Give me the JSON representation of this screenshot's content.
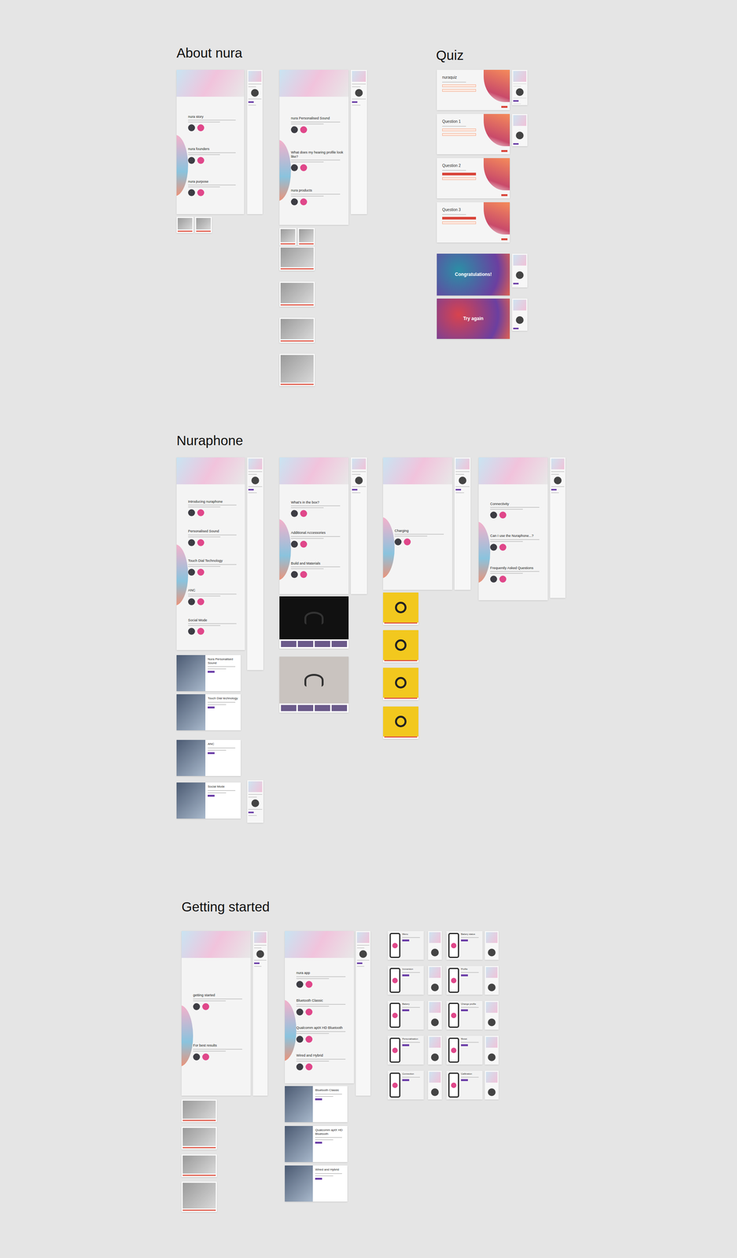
{
  "sections": [
    {
      "title": "About nura",
      "boards": [
        {
          "kind": "page",
          "headings": [
            "nura story",
            "nura founders",
            "nura purpose"
          ]
        },
        {
          "kind": "mobile"
        },
        {
          "kind": "thumb"
        },
        {
          "kind": "thumb"
        },
        {
          "kind": "page",
          "headings": [
            "nura Personalised Sound",
            "What does my hearing profile look like?",
            "nura products"
          ]
        },
        {
          "kind": "mobile"
        },
        {
          "kind": "thumb"
        },
        {
          "kind": "thumb"
        },
        {
          "kind": "thumb"
        },
        {
          "kind": "thumb"
        },
        {
          "kind": "thumb"
        },
        {
          "kind": "thumb"
        }
      ]
    },
    {
      "title": "Quiz",
      "boards": [
        {
          "kind": "quiz",
          "heading": "nuraquiz",
          "answered": false
        },
        {
          "kind": "mobile"
        },
        {
          "kind": "quiz",
          "heading": "Question 1",
          "answered": false
        },
        {
          "kind": "mobile"
        },
        {
          "kind": "quiz",
          "heading": "Question 2",
          "answered": true
        },
        {
          "kind": "quiz",
          "heading": "Question 3",
          "answered": true
        },
        {
          "kind": "result",
          "heading": "Congratulations!",
          "color": "#2b8fa6"
        },
        {
          "kind": "mobile"
        },
        {
          "kind": "result",
          "heading": "Try again",
          "color": "#d8434e"
        },
        {
          "kind": "mobile"
        }
      ]
    },
    {
      "title": "Nuraphone",
      "boards": [
        {
          "kind": "page",
          "headings": [
            "Introducing nuraphone",
            "Personalised Sound",
            "Touch Dial Technology",
            "ANC",
            "Social Mode"
          ]
        },
        {
          "kind": "mobile"
        },
        {
          "kind": "feature",
          "heading": "Nura Personalised Sound"
        },
        {
          "kind": "feature",
          "heading": "Touch Dial technology"
        },
        {
          "kind": "feature",
          "heading": "ANC"
        },
        {
          "kind": "feature",
          "heading": "Social Mode"
        },
        {
          "kind": "mobile"
        },
        {
          "kind": "page",
          "headings": [
            "What's in the box?",
            "Additional Accessories",
            "Build and Materials"
          ]
        },
        {
          "kind": "mobile"
        },
        {
          "kind": "gallery",
          "color": "#111111"
        },
        {
          "kind": "gallery",
          "color": "#c9c3bf"
        },
        {
          "kind": "page",
          "headings": [
            "Charging"
          ]
        },
        {
          "kind": "mobile"
        },
        {
          "kind": "swatch"
        },
        {
          "kind": "swatch"
        },
        {
          "kind": "swatch"
        },
        {
          "kind": "swatch"
        },
        {
          "kind": "page",
          "headings": [
            "Connectivity",
            "Can I use the Nuraphone...?",
            "Frequently Asked Questions"
          ]
        },
        {
          "kind": "mobile"
        }
      ]
    },
    {
      "title": "Getting started",
      "boards": [
        {
          "kind": "page",
          "headings": [
            "getting started",
            "For best results"
          ]
        },
        {
          "kind": "mobile"
        },
        {
          "kind": "thumb"
        },
        {
          "kind": "thumb"
        },
        {
          "kind": "thumb"
        },
        {
          "kind": "thumb"
        },
        {
          "kind": "page",
          "headings": [
            "nura app",
            "Bluetooth Classic",
            "Qualcomm aptX HD Bluetooth",
            "Wired and Hybrid"
          ]
        },
        {
          "kind": "mobile"
        },
        {
          "kind": "feature",
          "heading": "Bluetooth Classic"
        },
        {
          "kind": "feature",
          "heading": "Qualcomm aptX HD Bluetooth"
        },
        {
          "kind": "feature",
          "heading": "Wired and Hybrid"
        },
        {
          "kind": "phone",
          "heading": "Menu"
        },
        {
          "kind": "mobile"
        },
        {
          "kind": "phone",
          "heading": "Battery status"
        },
        {
          "kind": "mobile"
        },
        {
          "kind": "phone",
          "heading": "Immersion"
        },
        {
          "kind": "mobile"
        },
        {
          "kind": "phone",
          "heading": "Profile"
        },
        {
          "kind": "mobile"
        },
        {
          "kind": "phone",
          "heading": "Battery"
        },
        {
          "kind": "mobile"
        },
        {
          "kind": "phone",
          "heading": "Change profile"
        },
        {
          "kind": "mobile"
        },
        {
          "kind": "phone",
          "heading": "Personalisation"
        },
        {
          "kind": "mobile"
        },
        {
          "kind": "phone",
          "heading": "Reset"
        },
        {
          "kind": "mobile"
        },
        {
          "kind": "phone",
          "heading": "Connection"
        },
        {
          "kind": "mobile"
        },
        {
          "kind": "phone",
          "heading": "Calibration"
        },
        {
          "kind": "mobile"
        }
      ]
    }
  ]
}
